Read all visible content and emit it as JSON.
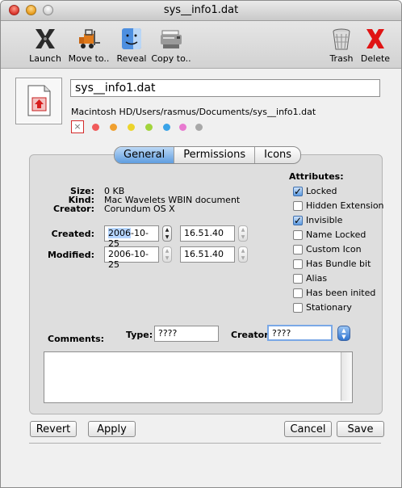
{
  "window": {
    "title": "sys__info1.dat"
  },
  "toolbar": {
    "launch": "Launch",
    "move_to": "Move to..",
    "reveal": "Reveal",
    "copy_to": "Copy to..",
    "trash": "Trash",
    "delete": "Delete"
  },
  "file": {
    "name": "sys__info1.dat",
    "path": "Macintosh HD/Users/rasmus/Documents/sys__info1.dat",
    "label_none_symbol": "×",
    "label_colors": [
      "#f05a5a",
      "#f0a030",
      "#ecd42c",
      "#a2d43c",
      "#3aa4e8",
      "#e87ad0",
      "#a8a8a8"
    ]
  },
  "tabs": [
    "General",
    "Permissions",
    "Icons"
  ],
  "general": {
    "size_label": "Size:",
    "size_value": "0 KB",
    "kind_label": "Kind:",
    "kind_value": "Mac Wavelets WBIN document",
    "creator_label": "Creator:",
    "creator_value": "Corundum OS X",
    "created_label": "Created:",
    "created_date_sel": "2006",
    "created_date_rest": "-10-25",
    "created_time": "16.51.40",
    "modified_label": "Modified:",
    "modified_date": "2006-10-25",
    "modified_time": "16.51.40",
    "comments_label": "Comments:",
    "type_label": "Type:",
    "type_value": "????",
    "creator_code_label": "Creator:",
    "creator_code_value": "????"
  },
  "attributes": {
    "title": "Attributes:",
    "items": [
      {
        "label": "Locked",
        "checked": true
      },
      {
        "label": "Hidden Extension",
        "checked": false
      },
      {
        "label": "Invisible",
        "checked": true
      },
      {
        "label": "Name Locked",
        "checked": false
      },
      {
        "label": "Custom Icon",
        "checked": false
      },
      {
        "label": "Has Bundle bit",
        "checked": false
      },
      {
        "label": "Alias",
        "checked": false
      },
      {
        "label": "Has been inited",
        "checked": false
      },
      {
        "label": "Stationary",
        "checked": false
      }
    ]
  },
  "buttons": {
    "revert": "Revert",
    "apply": "Apply",
    "cancel": "Cancel",
    "save": "Save"
  },
  "symbols": {
    "check": "✓",
    "step_up": "▲",
    "step_down": "▼"
  }
}
